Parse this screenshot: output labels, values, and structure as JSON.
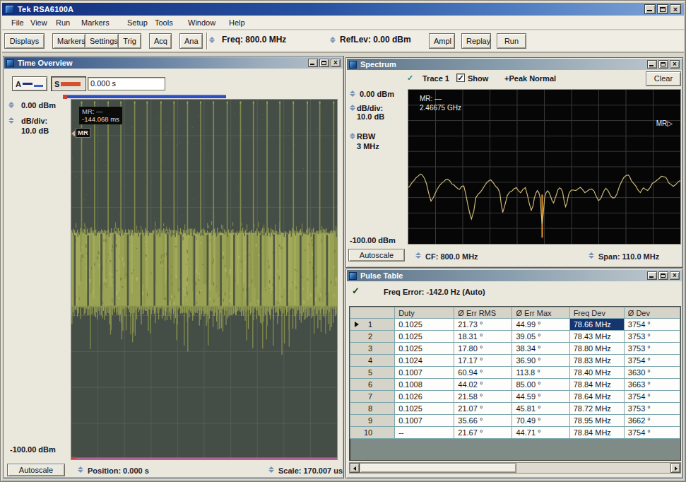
{
  "app": {
    "title": "Tek RSA6100A"
  },
  "menu": {
    "items": [
      "File",
      "View",
      "Run",
      "Markers",
      "Setup",
      "Tools",
      "Window",
      "Help"
    ]
  },
  "toolbar": {
    "displays_label": "Displays",
    "markers_label": "Markers",
    "settings_label": "Settings",
    "trig_label": "Trig",
    "acq_label": "Acq",
    "ana_label": "Ana",
    "freq_label": "Freq: 800.0 MHz",
    "reflev_label": "RefLev: 0.00 dBm",
    "ampl_label": "Ampl",
    "replay_label": "Replay",
    "run_label": "Run"
  },
  "time_overview": {
    "title": "Time Overview",
    "trace_a_label": "A",
    "trace_s_label": "S",
    "offset_value": "0.000 s",
    "top_level": "0.00 dBm",
    "db_div_label": "dB/div:",
    "db_div_value": "10.0 dB",
    "bottom_level": "-100.00 dBm",
    "autoscale_label": "Autoscale",
    "position_label": "Position: 0.000 s",
    "scale_label": "Scale: 170.007 us",
    "marker_readout_line1": "MR: —",
    "marker_readout_line2": "-144.068 ms",
    "marker_flag": "MR"
  },
  "spectrum": {
    "title": "Spectrum",
    "trace_label": "Trace 1",
    "show_label": "Show",
    "check_glyph": "✓",
    "detector_label": "+Peak Normal",
    "clear_label": "Clear",
    "top_level": "0.00 dBm",
    "db_div_label": "dB/div:",
    "db_div_value": "10.0 dB",
    "rbw_label": "RBW",
    "rbw_value": "3 MHz",
    "bottom_level": "-100.00 dBm",
    "autoscale_label": "Autoscale",
    "cf_label": "CF: 800.0 MHz",
    "span_label": "Span: 110.0 MHz",
    "marker_readout_line1": "MR: —",
    "marker_readout_line2": "2.46675 GHz",
    "marker_edge_label": "MR",
    "marker_edge_glyph": "▷"
  },
  "pulse_table": {
    "title": "Pulse Table",
    "check_glyph": "✓",
    "freq_error_label": "Freq Error: -142.0 Hz (Auto)",
    "columns": [
      "",
      "Duty",
      "Ø Err RMS",
      "Ø Err Max",
      "Freq Dev",
      "Ø Dev"
    ],
    "rows": [
      {
        "num": "1",
        "duty": "0.1025",
        "err_rms": "21.73 °",
        "err_max": "44.99 °",
        "freq_dev": "78.66 MHz",
        "dev": "3754 °"
      },
      {
        "num": "2",
        "duty": "0.1025",
        "err_rms": "18.31 °",
        "err_max": "39.05 °",
        "freq_dev": "78.43 MHz",
        "dev": "3753 °"
      },
      {
        "num": "3",
        "duty": "0.1025",
        "err_rms": "17.80 °",
        "err_max": "38.34 °",
        "freq_dev": "78.80 MHz",
        "dev": "3753 °"
      },
      {
        "num": "4",
        "duty": "0.1024",
        "err_rms": "17.17 °",
        "err_max": "36.90 °",
        "freq_dev": "78.83 MHz",
        "dev": "3754 °"
      },
      {
        "num": "5",
        "duty": "0.1007",
        "err_rms": "60.94 °",
        "err_max": "113.8 °",
        "freq_dev": "78.40 MHz",
        "dev": "3630 °"
      },
      {
        "num": "6",
        "duty": "0.1008",
        "err_rms": "44.02 °",
        "err_max": "85.00 °",
        "freq_dev": "78.84 MHz",
        "dev": "3663 °"
      },
      {
        "num": "7",
        "duty": "0.1026",
        "err_rms": "21.58 °",
        "err_max": "44.59 °",
        "freq_dev": "78.64 MHz",
        "dev": "3754 °"
      },
      {
        "num": "8",
        "duty": "0.1025",
        "err_rms": "21.07 °",
        "err_max": "45.81 °",
        "freq_dev": "78.72 MHz",
        "dev": "3753 °"
      },
      {
        "num": "9",
        "duty": "0.1007",
        "err_rms": "35.66 °",
        "err_max": "70.49 °",
        "freq_dev": "78.95 MHz",
        "dev": "3662 °"
      },
      {
        "num": "10",
        "duty": "--",
        "err_rms": "21.67 °",
        "err_max": "44.71 °",
        "freq_dev": "78.84 MHz",
        "dev": "3754 °"
      }
    ],
    "selected_cell": {
      "row": 0,
      "column": "freq_dev"
    }
  },
  "chart_data": [
    {
      "type": "area",
      "title": "Time Overview",
      "ylabel": "dBm",
      "ylim": [
        -100,
        0
      ],
      "db_per_div": 10,
      "x_position_s": "0.000 s",
      "x_scale": "170.007 us",
      "pulse_count": 20,
      "pulse_top_dbm": -0.5,
      "noise_band_top_dbm": -37,
      "noise_band_solid_bottom_dbm": -57.5,
      "noise_hair_bottom_dbm": -66,
      "baseline_marker_dbm": -99.5,
      "marker_time": "-144.068 ms"
    },
    {
      "type": "line",
      "title": "Spectrum",
      "center_frequency": "800.0 MHz",
      "span": "110.0 MHz",
      "rbw": "3 MHz",
      "ylim": [
        -100,
        0
      ],
      "db_per_div": 10,
      "marker": {
        "name": "MR",
        "frequency": "2.46675 GHz",
        "offscreen_right": true
      },
      "notch": {
        "frac": 0.492,
        "bottom_dbm": -96
      },
      "trace": [
        [
          0.001,
          -63.7
        ],
        [
          0.029,
          -57.1
        ],
        [
          0.051,
          -55.2
        ],
        [
          0.067,
          -60.9
        ],
        [
          0.083,
          -72.2
        ],
        [
          0.1,
          -66.6
        ],
        [
          0.122,
          -60.9
        ],
        [
          0.144,
          -58.1
        ],
        [
          0.16,
          -60.9
        ],
        [
          0.188,
          -64.7
        ],
        [
          0.204,
          -62.8
        ],
        [
          0.232,
          -83.5
        ],
        [
          0.248,
          -70.3
        ],
        [
          0.265,
          -66.6
        ],
        [
          0.287,
          -60.9
        ],
        [
          0.303,
          -58.1
        ],
        [
          0.32,
          -62.8
        ],
        [
          0.336,
          -66.6
        ],
        [
          0.347,
          -79.8
        ],
        [
          0.364,
          -68.4
        ],
        [
          0.38,
          -65.6
        ],
        [
          0.397,
          -63.7
        ],
        [
          0.413,
          -66.6
        ],
        [
          0.43,
          -63.7
        ],
        [
          0.452,
          -77.9
        ],
        [
          0.463,
          -70.3
        ],
        [
          0.474,
          -65.6
        ],
        [
          0.485,
          -70.3
        ],
        [
          0.492,
          -87.3
        ],
        [
          0.501,
          -70.3
        ],
        [
          0.512,
          -65.6
        ],
        [
          0.523,
          -69.4
        ],
        [
          0.534,
          -73.2
        ],
        [
          0.545,
          -67.5
        ],
        [
          0.556,
          -63.7
        ],
        [
          0.567,
          -66.6
        ],
        [
          0.578,
          -76.0
        ],
        [
          0.589,
          -68.4
        ],
        [
          0.6,
          -64.7
        ],
        [
          0.616,
          -65.6
        ],
        [
          0.633,
          -63.7
        ],
        [
          0.649,
          -66.6
        ],
        [
          0.666,
          -64.7
        ],
        [
          0.682,
          -65.6
        ],
        [
          0.699,
          -72.2
        ],
        [
          0.715,
          -67.5
        ],
        [
          0.726,
          -63.7
        ],
        [
          0.743,
          -68.4
        ],
        [
          0.759,
          -70.3
        ],
        [
          0.776,
          -62.8
        ],
        [
          0.792,
          -57.1
        ],
        [
          0.809,
          -55.2
        ],
        [
          0.82,
          -59.0
        ],
        [
          0.836,
          -62.8
        ],
        [
          0.853,
          -66.6
        ],
        [
          0.864,
          -63.7
        ],
        [
          0.88,
          -65.6
        ],
        [
          0.897,
          -60.9
        ],
        [
          0.913,
          -59.0
        ],
        [
          0.93,
          -56.2
        ],
        [
          0.946,
          -57.1
        ],
        [
          0.957,
          -60.0
        ],
        [
          0.974,
          -62.8
        ],
        [
          0.985,
          -60.9
        ],
        [
          1,
          -59.0
        ]
      ]
    }
  ]
}
